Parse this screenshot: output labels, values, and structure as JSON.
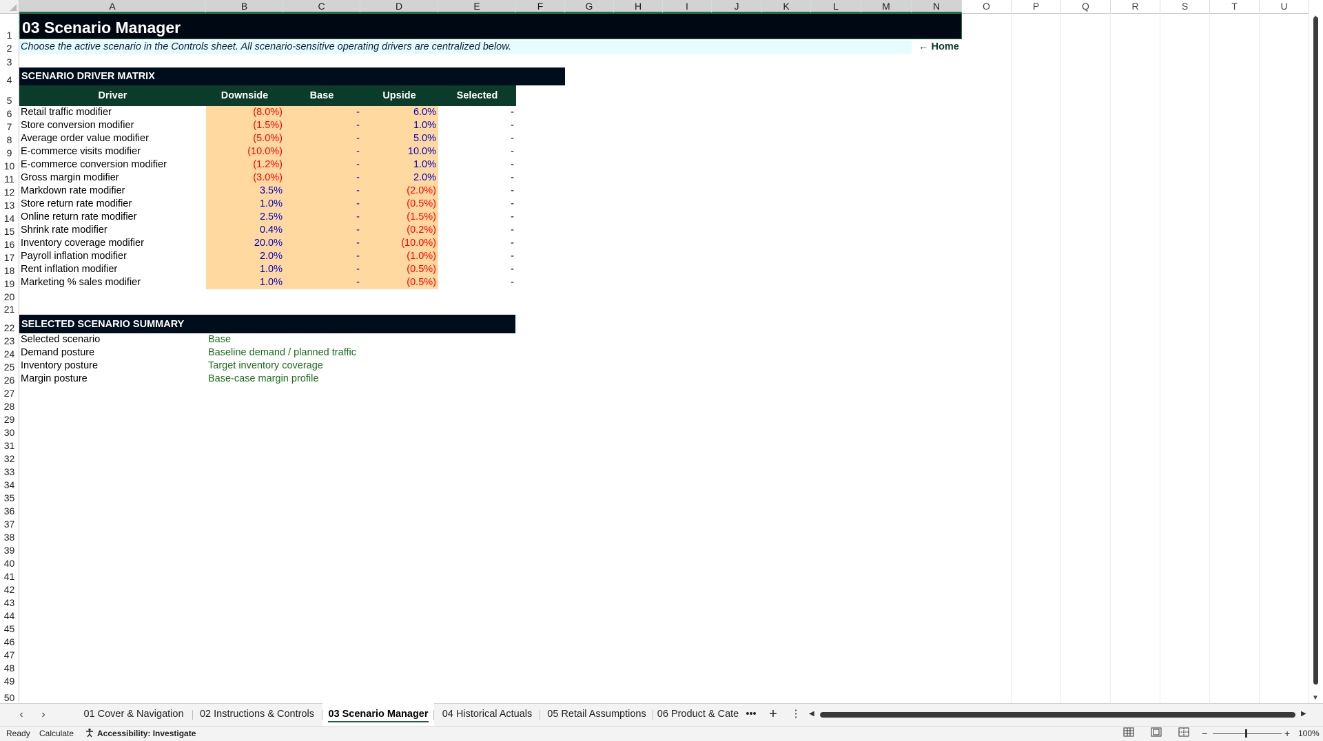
{
  "columns": [
    "A",
    "B",
    "C",
    "D",
    "E",
    "F",
    "G",
    "H",
    "I",
    "J",
    "K",
    "L",
    "M",
    "N",
    "O",
    "P",
    "Q",
    "R",
    "S",
    "T",
    "U"
  ],
  "rows": [
    "1",
    "2",
    "3",
    "4",
    "5",
    "6",
    "7",
    "8",
    "9",
    "10",
    "11",
    "12",
    "13",
    "14",
    "15",
    "16",
    "17",
    "18",
    "19",
    "20",
    "21",
    "22",
    "23",
    "24",
    "25",
    "26",
    "27",
    "28",
    "29",
    "30",
    "31",
    "32",
    "33",
    "34",
    "35",
    "36",
    "37",
    "38",
    "39",
    "40",
    "41",
    "42",
    "43",
    "44",
    "45",
    "46",
    "47",
    "48",
    "49",
    "50"
  ],
  "sheet": {
    "title": "03 Scenario Manager",
    "subtitle": "Choose the active scenario in the Controls sheet. All scenario-sensitive operating drivers are centralized below.",
    "home_link": "← Home",
    "section1": "SCENARIO DRIVER MATRIX",
    "headers": [
      "Driver",
      "Downside",
      "Base",
      "Upside",
      "Selected"
    ],
    "drivers": [
      {
        "driver": "Retail traffic modifier",
        "downside": "(8.0%)",
        "base": "-",
        "upside": "6.0%",
        "selected": "-"
      },
      {
        "driver": "Store conversion modifier",
        "downside": "(1.5%)",
        "base": "-",
        "upside": "1.0%",
        "selected": "-"
      },
      {
        "driver": "Average order value modifier",
        "downside": "(5.0%)",
        "base": "-",
        "upside": "5.0%",
        "selected": "-"
      },
      {
        "driver": "E-commerce visits modifier",
        "downside": "(10.0%)",
        "base": "-",
        "upside": "10.0%",
        "selected": "-"
      },
      {
        "driver": "E-commerce conversion modifier",
        "downside": "(1.2%)",
        "base": "-",
        "upside": "1.0%",
        "selected": "-"
      },
      {
        "driver": "Gross margin modifier",
        "downside": "(3.0%)",
        "base": "-",
        "upside": "2.0%",
        "selected": "-"
      },
      {
        "driver": "Markdown rate modifier",
        "downside": "3.5%",
        "base": "-",
        "upside": "(2.0%)",
        "selected": "-"
      },
      {
        "driver": "Store return rate modifier",
        "downside": "1.0%",
        "base": "-",
        "upside": "(0.5%)",
        "selected": "-"
      },
      {
        "driver": "Online return rate modifier",
        "downside": "2.5%",
        "base": "-",
        "upside": "(1.5%)",
        "selected": "-"
      },
      {
        "driver": "Shrink rate modifier",
        "downside": "0.4%",
        "base": "-",
        "upside": "(0.2%)",
        "selected": "-"
      },
      {
        "driver": "Inventory coverage modifier",
        "downside": "20.0%",
        "base": "-",
        "upside": "(10.0%)",
        "selected": "-"
      },
      {
        "driver": "Payroll inflation modifier",
        "downside": "2.0%",
        "base": "-",
        "upside": "(1.0%)",
        "selected": "-"
      },
      {
        "driver": "Rent inflation modifier",
        "downside": "1.0%",
        "base": "-",
        "upside": "(0.5%)",
        "selected": "-"
      },
      {
        "driver": "Marketing % sales modifier",
        "downside": "1.0%",
        "base": "-",
        "upside": "(0.5%)",
        "selected": "-"
      }
    ],
    "section2": "SELECTED SCENARIO SUMMARY",
    "summary": [
      {
        "label": "Selected scenario",
        "value": "Base"
      },
      {
        "label": "Demand posture",
        "value": "Baseline demand / planned traffic"
      },
      {
        "label": "Inventory posture",
        "value": "Target inventory coverage"
      },
      {
        "label": "Margin posture",
        "value": "Base-case margin profile"
      }
    ]
  },
  "tabs": [
    "01 Cover & Navigation",
    "02 Instructions & Controls",
    "03 Scenario Manager",
    "04 Historical Actuals",
    "05 Retail Assumptions",
    "06 Product & Cate"
  ],
  "active_tab": "03 Scenario Manager",
  "tab_more": "•••",
  "add_sheet": "+",
  "tab_options": "⋮",
  "status": {
    "ready": "Ready",
    "calculate": "Calculate",
    "accessibility": "Accessibility: Investigate",
    "zoom": "100%"
  },
  "colors": {
    "title_bg": "#000814",
    "section_bg": "#000d1a",
    "header_bg": "#0b3b2b",
    "input_fill": "#ffd9a0",
    "negative": "#ff0000",
    "positive": "#0000cc",
    "summary_value": "#1a6b1a"
  }
}
